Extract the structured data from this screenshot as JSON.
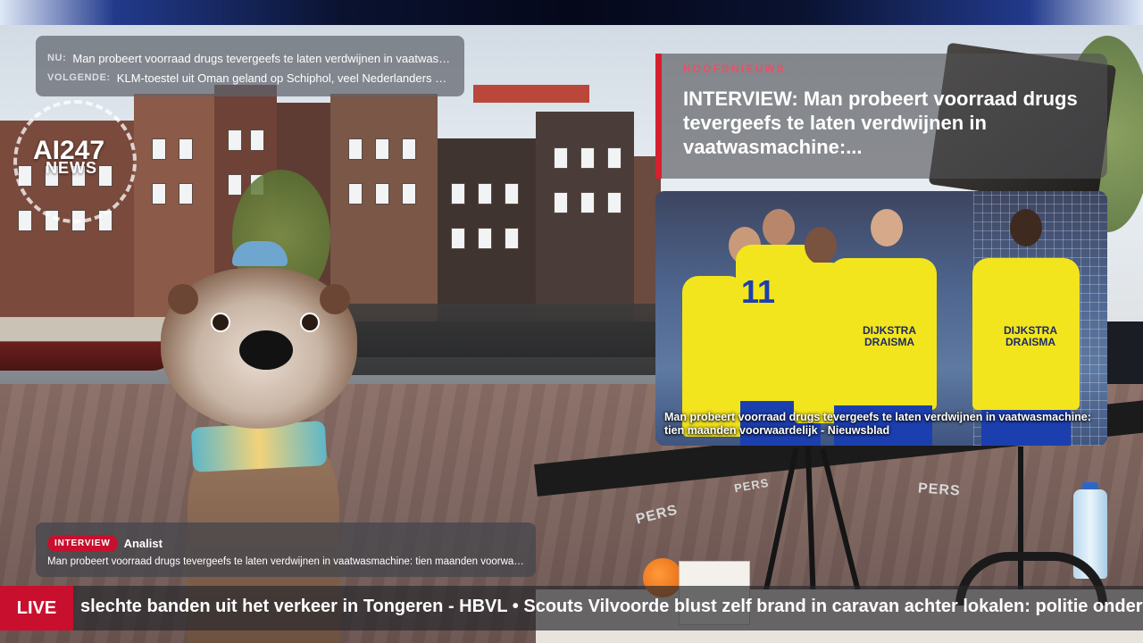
{
  "now_next": {
    "now_label": "NU:",
    "now_text": "Man probeert voorraad drugs tevergeefs te laten verdwijnen in vaatwasmachine: tien maanden voorwaardelijk",
    "next_label": "VOLGENDE:",
    "next_text": "KLM-toestel uit Oman geland op Schiphol, veel Nederlanders aan boord"
  },
  "logo": {
    "ai": "AI247",
    "news": "NEWS"
  },
  "headline": {
    "kicker": "HOOFDNIEUWS",
    "title": "INTERVIEW: Man probeert voorraad drugs tevergeefs te laten verdwijnen in vaatwasmachine:..."
  },
  "news_card": {
    "caption": "Man probeert voorraad drugs tevergeefs te laten verdwijnen in vaatwasmachine: tien maanden voorwaardelijk - Nieuwsblad",
    "jersey_number": "11",
    "sponsor_1": "DIJKSTRA DRAISMA",
    "sponsor_2": "DIJKSTRA DRAISMA"
  },
  "lower_third": {
    "badge": "INTERVIEW",
    "role": "Analist",
    "text": "Man probeert voorraad drugs tevergeefs te laten verdwijnen in vaatwasmachine: tien maanden voorwaardelijk"
  },
  "ticker": {
    "live_label": "LIVE",
    "text": "slechte banden uit het verkeer in Tongeren - HBVL • Scouts Vilvoorde blust zelf brand in caravan achter lokalen: politie onderzoekt"
  },
  "scene": {
    "pers_1": "PERS",
    "pers_2": "PERS",
    "pers_3": "PERS"
  },
  "colors": {
    "accent_red": "#c8102e",
    "kicker_pink": "#ef4d66"
  }
}
